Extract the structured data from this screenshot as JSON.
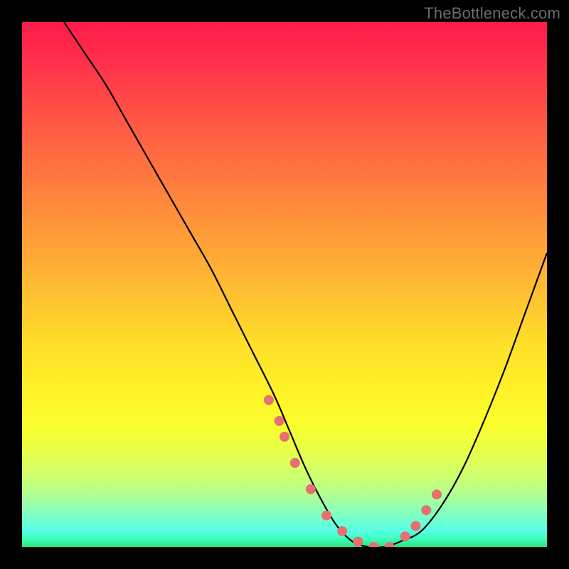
{
  "watermark": "TheBottleneck.com",
  "chart_data": {
    "type": "line",
    "title": "",
    "xlabel": "",
    "ylabel": "",
    "xlim": [
      0,
      100
    ],
    "ylim": [
      0,
      100
    ],
    "series": [
      {
        "name": "curve",
        "x": [
          8,
          12,
          16,
          20,
          24,
          28,
          32,
          36,
          40,
          44,
          48,
          51,
          54,
          57,
          60,
          63,
          66,
          69,
          72,
          76,
          80,
          84,
          88,
          92,
          96,
          100
        ],
        "y": [
          100,
          94,
          88,
          81,
          74,
          67,
          60,
          53,
          45,
          37,
          29,
          22,
          15,
          9,
          4,
          1,
          0,
          0,
          1,
          3,
          8,
          15,
          24,
          34,
          45,
          56
        ]
      }
    ],
    "markers": {
      "name": "highlight-points",
      "color": "#e4716f",
      "x": [
        47,
        49,
        50,
        52,
        55,
        58,
        61,
        64,
        67,
        70,
        73,
        75,
        77,
        79
      ],
      "y": [
        28,
        24,
        21,
        16,
        11,
        6,
        3,
        1,
        0,
        0,
        2,
        4,
        7,
        10
      ]
    },
    "background_gradient": {
      "top": "#ff1a4b",
      "mid": "#ffe02a",
      "bottom": "#29e37e"
    }
  }
}
